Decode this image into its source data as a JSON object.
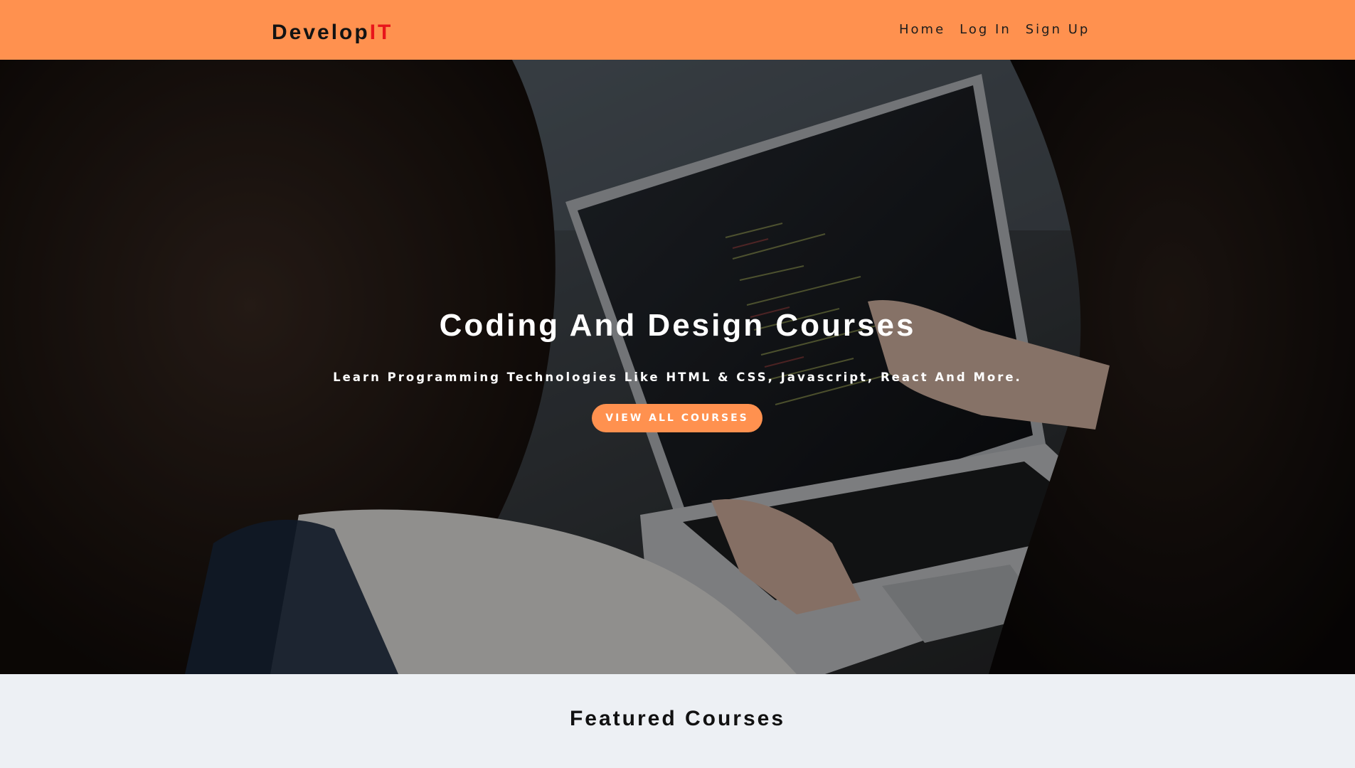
{
  "brand": {
    "name_main": "Develop",
    "name_accent": "IT"
  },
  "nav": {
    "items": [
      {
        "label": "Home"
      },
      {
        "label": "Log In"
      },
      {
        "label": "Sign Up"
      }
    ]
  },
  "hero": {
    "title": "Coding And Design Courses",
    "subtitle": "Learn Programming Technologies Like HTML & CSS, Javascript, React And More.",
    "cta_label": "VIEW ALL COURSES"
  },
  "featured": {
    "title": "Featured Courses"
  },
  "colors": {
    "nav_background": "#ff914f",
    "brand_accent": "#e8151b",
    "cta_background": "#ff914f",
    "section_background": "#edf0f4"
  }
}
